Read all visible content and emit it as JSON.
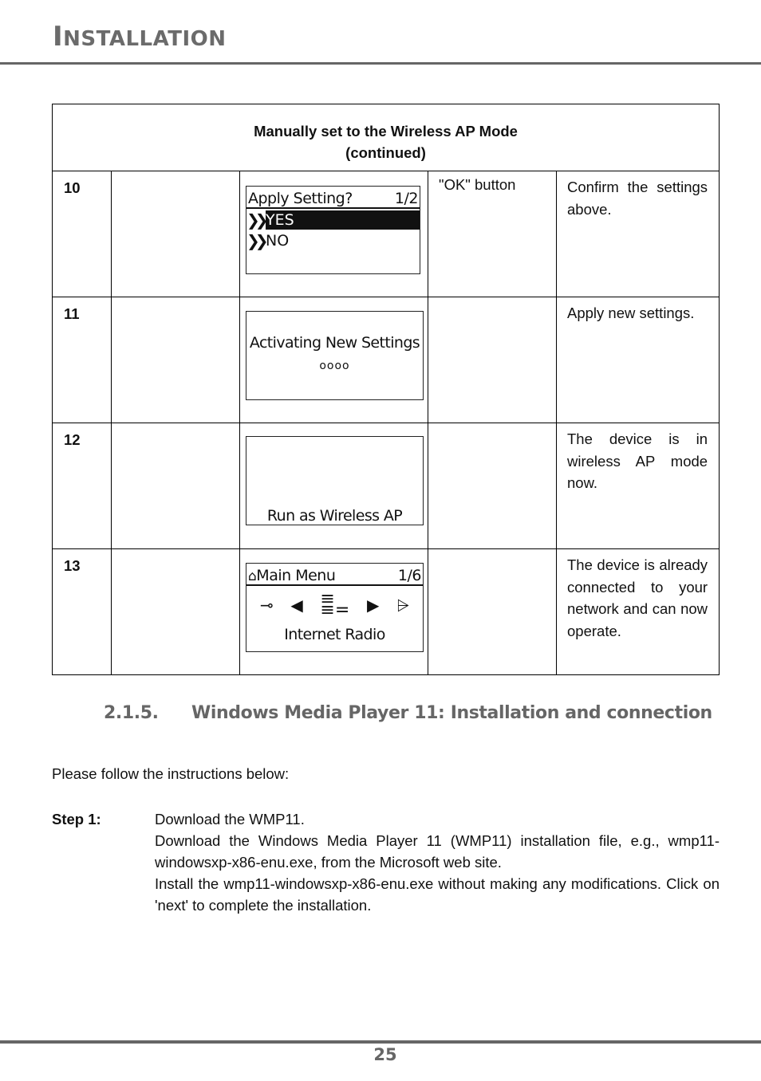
{
  "header": {
    "title_first_letter": "I",
    "title_rest": "NSTALLATION"
  },
  "table": {
    "caption_line1": "Manually set to the Wireless AP Mode",
    "caption_line2": "(continued)",
    "rows": [
      {
        "number": "10",
        "action": "\"OK\" button",
        "description": "Confirm the settings above.",
        "screen": {
          "title": "Apply Setting?",
          "page": "1/2",
          "options": [
            {
              "label": "YES",
              "selected": true
            },
            {
              "label": "NO",
              "selected": false
            }
          ]
        }
      },
      {
        "number": "11",
        "action": "",
        "description": "Apply new settings.",
        "screen": {
          "text": "Activating New Settings",
          "progress": "oooo"
        }
      },
      {
        "number": "12",
        "action": "",
        "description": "The device is in wireless AP mode now.",
        "screen": {
          "text": "Run as Wireless AP"
        }
      },
      {
        "number": "13",
        "action": "",
        "description": "The device is already connected to your network and can now operate.",
        "screen": {
          "title": "Main Menu",
          "page": "1/6",
          "icons": [
            "wrench-icon",
            "prev-icon",
            "internet-radio-icon",
            "next-icon",
            "tower-icon"
          ],
          "selected_item": "Internet Radio"
        }
      }
    ]
  },
  "section": {
    "number": "2.1.5.",
    "title": "Windows Media Player 11: Installation and connection"
  },
  "intro": "Please follow the instructions below:",
  "step1": {
    "label": "Step 1:",
    "lines": [
      "Download the WMP11.",
      "Download the Windows Media Player 11 (WMP11) installation file, e.g., wmp11-windowsxp-x86-enu.exe, from the Microsoft web site.",
      "Install the wmp11-windowsxp-x86-enu.exe without making any modifications. Click on 'next' to complete the installation."
    ]
  },
  "footer": {
    "page_number": "25"
  }
}
